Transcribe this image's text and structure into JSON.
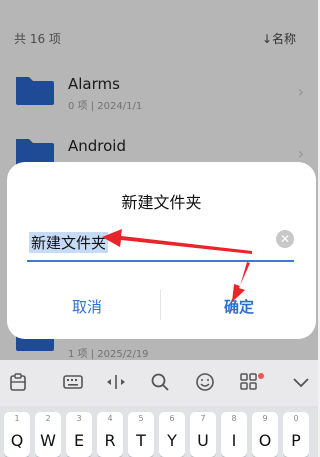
{
  "header": {
    "count_label": "共 16 项",
    "sort_label": "↓名称"
  },
  "folders": [
    {
      "name": "Alarms",
      "meta": "0 项  |  2024/1/1"
    },
    {
      "name": "Android",
      "meta": ""
    },
    {
      "name": "",
      "meta": "1 项  |  2025/2/19"
    }
  ],
  "dialog": {
    "title": "新建文件夹",
    "input_value": "新建文件夹",
    "cancel_label": "取消",
    "confirm_label": "确定"
  },
  "toolbar": {
    "icons": [
      "clipboard-icon",
      "keyboard-icon",
      "cursor-move-icon",
      "search-icon",
      "emoji-icon",
      "apps-icon",
      "collapse-keyboard-icon"
    ]
  },
  "keyboard": {
    "keys": [
      {
        "num": "1",
        "letter": "Q"
      },
      {
        "num": "2",
        "letter": "W"
      },
      {
        "num": "3",
        "letter": "E"
      },
      {
        "num": "4",
        "letter": "R"
      },
      {
        "num": "5",
        "letter": "T"
      },
      {
        "num": "6",
        "letter": "Y"
      },
      {
        "num": "7",
        "letter": "U"
      },
      {
        "num": "8",
        "letter": "I"
      },
      {
        "num": "9",
        "letter": "O"
      },
      {
        "num": "0",
        "letter": "P"
      }
    ]
  },
  "colors": {
    "accent": "#2f6fd0",
    "folder_blue": "#2a63c8",
    "annotation_red": "#e8252b",
    "selection": "#c6dcf6"
  }
}
